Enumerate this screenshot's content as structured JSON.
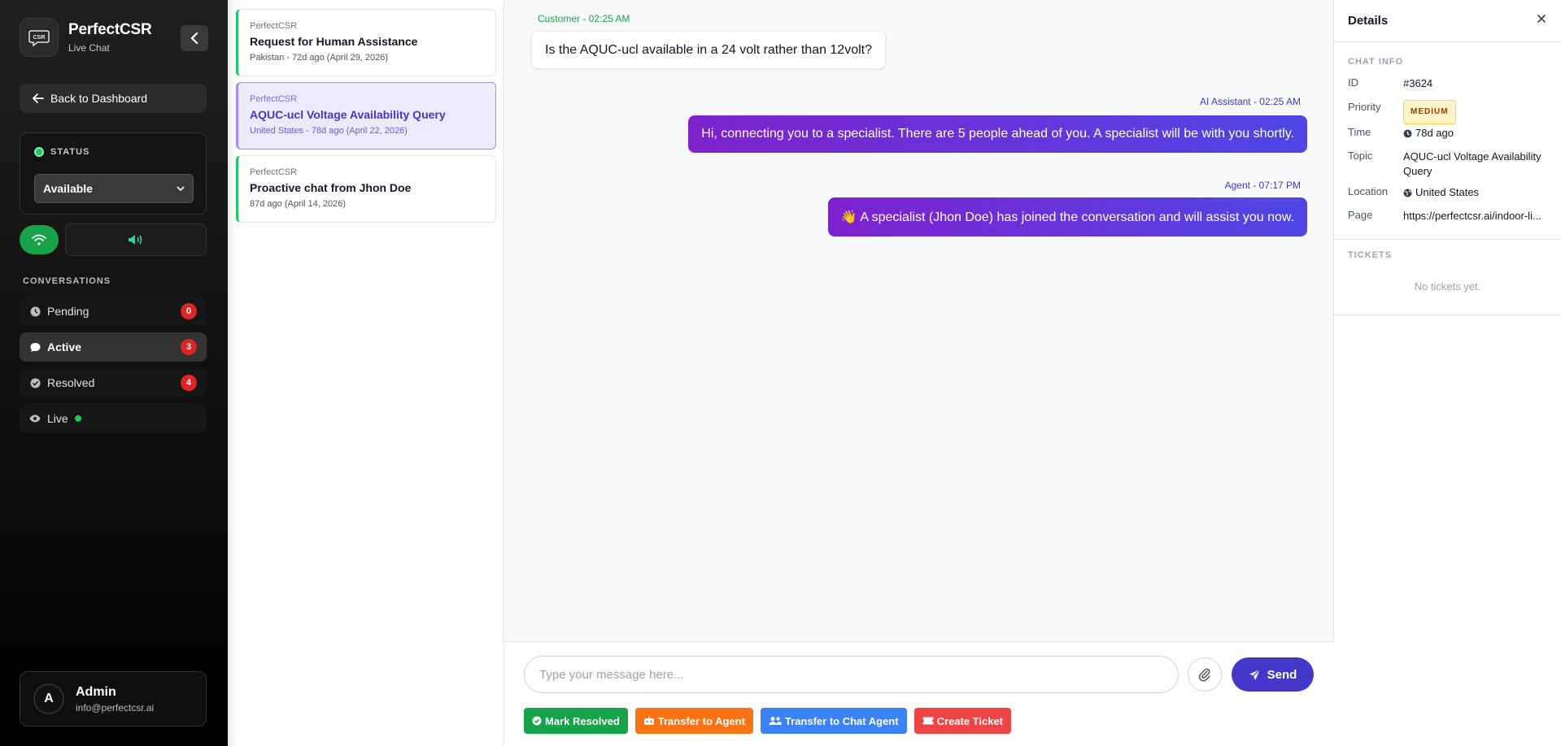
{
  "brand": {
    "name": "PerfectCSR",
    "subtitle": "Live Chat",
    "logo_text": "CSR"
  },
  "sidebar": {
    "back_label": "Back to Dashboard",
    "status_label": "STATUS",
    "status_value": "Available",
    "conversations_label": "CONVERSATIONS",
    "nav": [
      {
        "label": "Pending",
        "count": "0",
        "icon": "clock-icon"
      },
      {
        "label": "Active",
        "count": "3",
        "icon": "chat-bubble-icon"
      },
      {
        "label": "Resolved",
        "count": "4",
        "icon": "check-circle-icon"
      },
      {
        "label": "Live",
        "icon": "eye-icon"
      }
    ],
    "user": {
      "initial": "A",
      "name": "Admin",
      "email": "info@perfectcsr.ai"
    }
  },
  "conversations": [
    {
      "source": "PerfectCSR",
      "title": "Request for Human Assistance",
      "meta": "Pakistan - 72d ago (April 29, 2026)"
    },
    {
      "source": "PerfectCSR",
      "title": "AQUC-ucl Voltage Availability Query",
      "meta": "United States - 78d ago (April 22, 2026)"
    },
    {
      "source": "PerfectCSR",
      "title": "Proactive chat from Jhon Doe",
      "meta": "87d ago (April 14, 2026)"
    }
  ],
  "messages": [
    {
      "sender": "Customer - 02:25 AM",
      "text": "Is the AQUC-ucl available in a 24 volt rather than 12volt?"
    },
    {
      "sender": "AI Assistant - 02:25 AM",
      "text": "Hi, connecting you to a specialist. There are 5 people ahead of you. A specialist will be with you shortly."
    },
    {
      "sender": "Agent - 07:17 PM",
      "text": "👋 A specialist (Jhon Doe) has joined the conversation and will assist you now."
    }
  ],
  "composer": {
    "placeholder": "Type your message here...",
    "send_label": "Send",
    "actions": [
      {
        "label": "Mark Resolved",
        "color": "#16a34a"
      },
      {
        "label": "Transfer to Agent",
        "color": "#f97316"
      },
      {
        "label": "Transfer to Chat Agent",
        "color": "#3b82f6"
      },
      {
        "label": "Create Ticket",
        "color": "#ef4444"
      }
    ]
  },
  "details": {
    "title": "Details",
    "chat_info_label": "CHAT INFO",
    "fields": {
      "id_label": "ID",
      "id_value": "#3624",
      "priority_label": "Priority",
      "priority_value": "MEDIUM",
      "time_label": "Time",
      "time_value": "78d ago",
      "topic_label": "Topic",
      "topic_value": "AQUC-ucl Voltage Availability Query",
      "location_label": "Location",
      "location_value": "United States",
      "page_label": "Page",
      "page_value": "https://perfectcsr.ai/indoor-li..."
    },
    "tickets_label": "TICKETS",
    "no_tickets": "No tickets yet."
  },
  "colors": {
    "accent": "#4338ca",
    "status_green": "#22c55e",
    "badge_red": "#dc2626"
  }
}
